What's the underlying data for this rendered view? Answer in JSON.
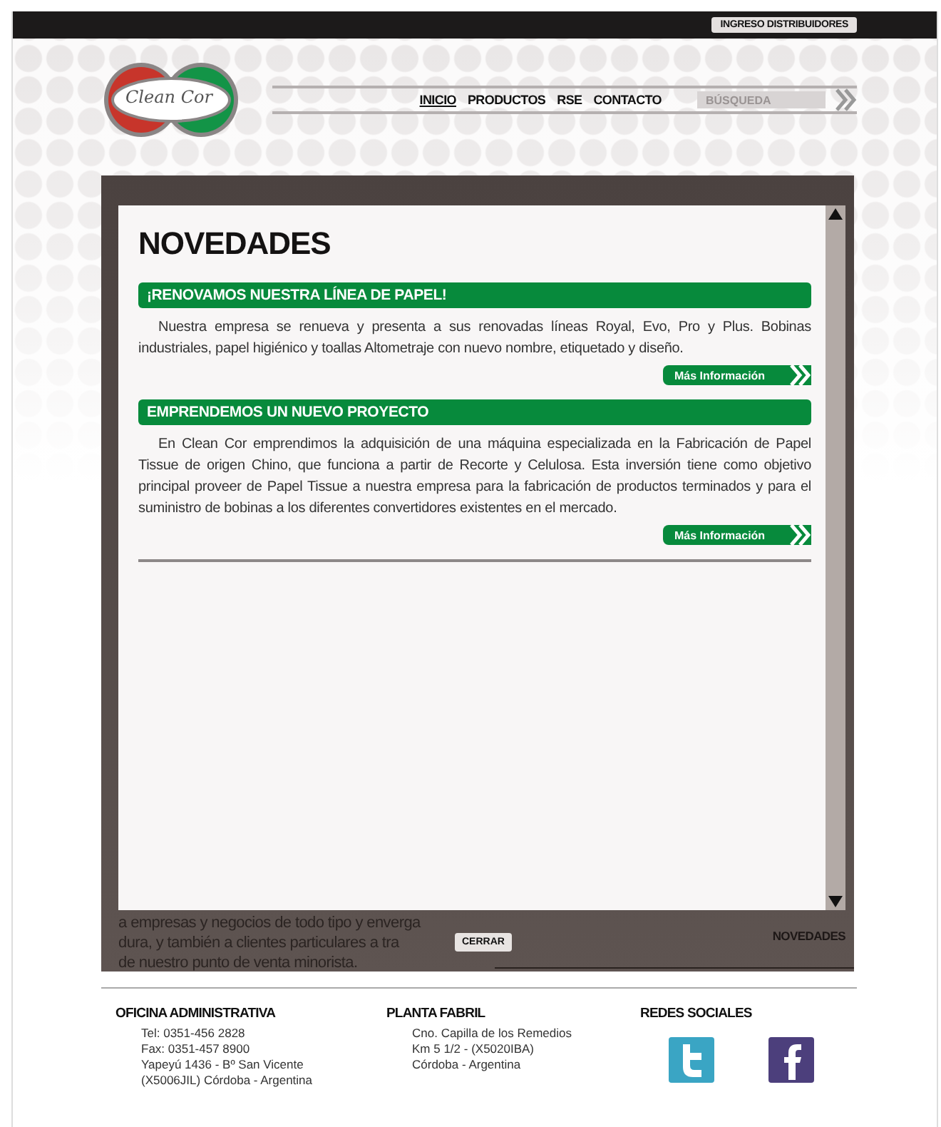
{
  "top_bar": {
    "distributor_button": "INGRESO DISTRIBUIDORES"
  },
  "header": {
    "logo": "Clean Cor",
    "nav": [
      {
        "label": "INICIO",
        "selected": true
      },
      {
        "label": "PRODUCTOS",
        "selected": false
      },
      {
        "label": "RSE",
        "selected": false
      },
      {
        "label": "CONTACTO",
        "selected": false
      }
    ],
    "search": {
      "placeholder": "BÚSQUEDA"
    }
  },
  "background_page": {
    "text_lines": [
      "a empresas y negocios de todo tipo y enverga",
      "dura, y también a clientes particulares a tra",
      "de nuestro punto de venta minorista."
    ],
    "section_label": "NOVEDADES"
  },
  "modal": {
    "title": "NOVEDADES",
    "news": [
      {
        "heading": "¡RENOVAMOS NUESTRA LÍNEA DE PAPEL!",
        "body": "Nuestra empresa se renueva y presenta a sus renovadas líneas Royal, Evo, Pro y Plus. Bobinas industriales, papel higiénico y toallas Altometraje con nuevo nombre, etiquetado y diseño.",
        "more_button": "Más Información"
      },
      {
        "heading": "EMPRENDEMOS UN NUEVO PROYECTO",
        "body": "En Clean Cor emprendimos la adquisición de una máquina especializada en la Fabricación de Papel Tissue de origen Chino, que funciona a partir de Recorte y Celulosa. Esta inversión tiene como objetivo principal proveer de Papel Tissue a nuestra empresa para la fabricación de productos terminados y para el suministro de bobinas a los diferentes convertidores existentes en el mercado.",
        "more_button": "Más Información"
      }
    ],
    "close_button": "CERRAR"
  },
  "footer": {
    "columns": [
      {
        "title": "OFICINA ADMINISTRATIVA",
        "lines": [
          "Tel: 0351-456 2828",
          "Fax: 0351-457 8900",
          "Yapeyú 1436 - Bº San Vicente",
          "(X5006JIL) Córdoba - Argentina"
        ]
      },
      {
        "title": "PLANTA FABRIL",
        "lines": [
          "Cno. Capilla de los Remedios",
          "Km 5 1/2 - (X5020IBA)",
          "Córdoba - Argentina"
        ]
      }
    ],
    "social": {
      "title": "REDES SOCIALES"
    }
  }
}
